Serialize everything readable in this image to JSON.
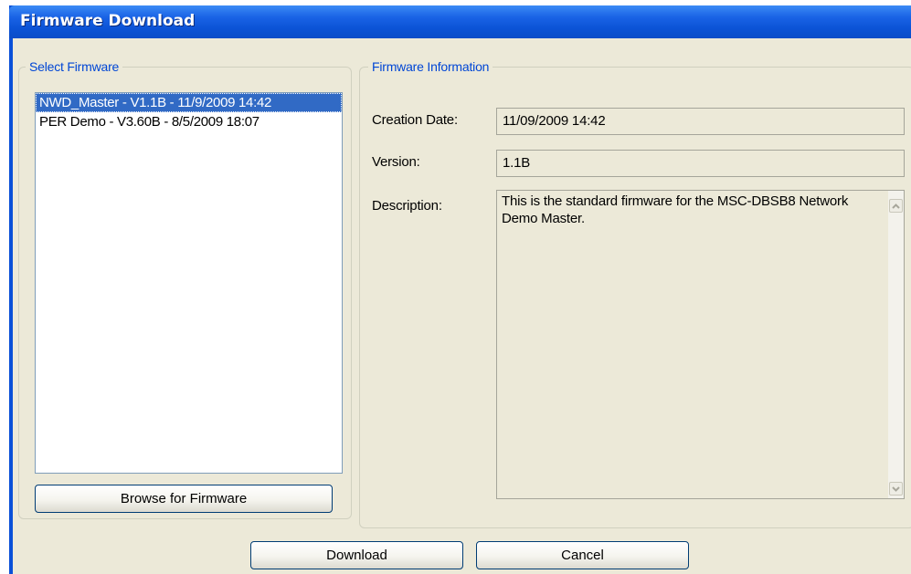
{
  "window": {
    "title": "Firmware Download"
  },
  "select_group": {
    "legend": "Select Firmware",
    "items": [
      {
        "label": "NWD_Master - V1.1B - 11/9/2009 14:42",
        "selected": true
      },
      {
        "label": "PER Demo - V3.60B - 8/5/2009 18:07",
        "selected": false
      }
    ],
    "browse_label": "Browse for Firmware"
  },
  "info_group": {
    "legend": "Firmware Information",
    "creation_date_label": "Creation Date:",
    "creation_date_value": "11/09/2009 14:42",
    "version_label": "Version:",
    "version_value": "1.1B",
    "description_label": "Description:",
    "description_value": "This is the standard firmware for the MSC-DBSB8 Network Demo Master."
  },
  "footer": {
    "download_label": "Download",
    "cancel_label": "Cancel"
  },
  "icons": {
    "scroll_up": "chevron-up-icon",
    "scroll_down": "chevron-down-icon"
  },
  "colors": {
    "titlebar": "#0a50d8",
    "selection": "#316ac5",
    "legend_text": "#0046d5",
    "dialog_bg": "#ece9d8"
  }
}
